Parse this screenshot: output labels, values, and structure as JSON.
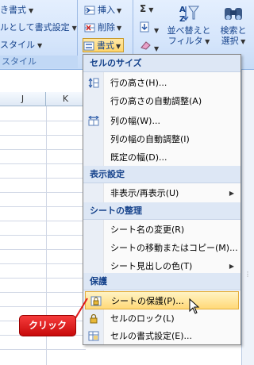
{
  "ribbon": {
    "styles_group": {
      "cond_format_label": "き書式",
      "table_format_label": "ルとして書式設定",
      "cell_style_label": "スタイル",
      "footer": "スタイル"
    },
    "cells_group": {
      "insert_label": "挿入",
      "delete_label": "削除",
      "format_label": "書式"
    },
    "edit_group": {
      "sum_symbol": "Σ",
      "sort_label_1": "並べ替えと",
      "sort_label_2": "フィルタ",
      "find_label_1": "検索と",
      "find_label_2": "選択"
    }
  },
  "sheet": {
    "columns": [
      "J",
      "K"
    ]
  },
  "menu": {
    "sections": [
      {
        "header": "セルのサイズ",
        "items": [
          {
            "label": "行の高さ(H)...",
            "icon": "row-height-icon"
          },
          {
            "label": "行の高さの自動調整(A)",
            "icon": ""
          },
          {
            "label": "列の幅(W)...",
            "icon": "column-width-icon"
          },
          {
            "label": "列の幅の自動調整(I)",
            "icon": ""
          },
          {
            "label": "既定の幅(D)...",
            "icon": ""
          }
        ]
      },
      {
        "header": "表示設定",
        "items": [
          {
            "label": "非表示/再表示(U)",
            "icon": "",
            "submenu": true
          }
        ]
      },
      {
        "header": "シートの整理",
        "items": [
          {
            "label": "シート名の変更(R)",
            "icon": ""
          },
          {
            "label": "シートの移動またはコピー(M)...",
            "icon": ""
          },
          {
            "label": "シート見出しの色(T)",
            "icon": "",
            "submenu": true
          }
        ]
      },
      {
        "header": "保護",
        "items": [
          {
            "label": "シートの保護(P)...",
            "icon": "lock-sheet-icon",
            "highlighted": true
          },
          {
            "label": "セルのロック(L)",
            "icon": "lock-icon"
          },
          {
            "label": "セルの書式設定(E)...",
            "icon": "format-cells-icon"
          }
        ]
      }
    ]
  },
  "callout": {
    "label": "クリック",
    "color": "#e01b1b"
  }
}
